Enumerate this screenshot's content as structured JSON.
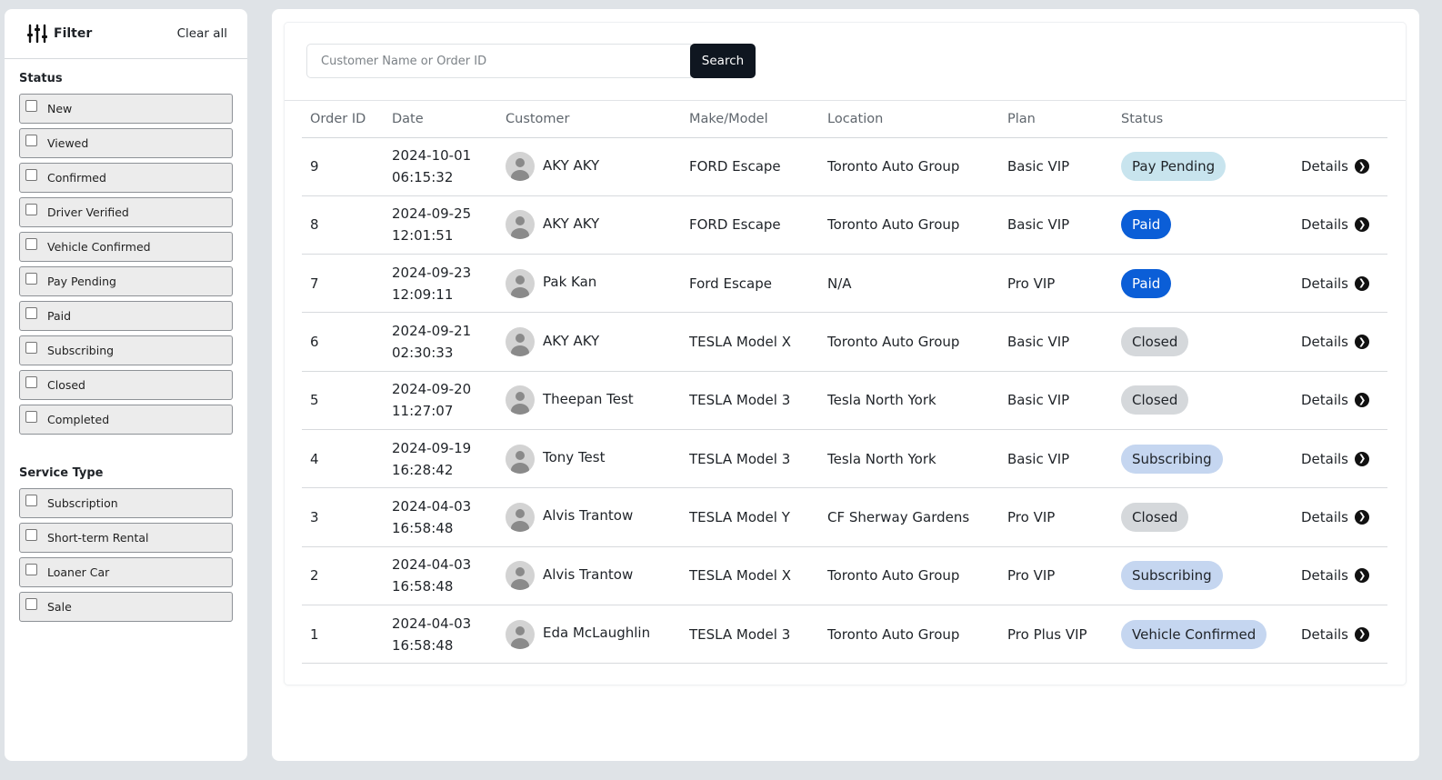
{
  "sidebar": {
    "title": "Filter",
    "clear_all": "Clear all",
    "status_title": "Status",
    "status_options": [
      "New",
      "Viewed",
      "Confirmed",
      "Driver Verified",
      "Vehicle Confirmed",
      "Pay Pending",
      "Paid",
      "Subscribing",
      "Closed",
      "Completed"
    ],
    "service_title": "Service Type",
    "service_options": [
      "Subscription",
      "Short-term Rental",
      "Loaner Car",
      "Sale"
    ]
  },
  "search": {
    "placeholder": "Customer Name or Order ID",
    "button": "Search"
  },
  "table": {
    "headers": [
      "Order ID",
      "Date",
      "Customer",
      "Make/Model",
      "Location",
      "Plan",
      "Status",
      ""
    ],
    "details_label": "Details",
    "status_colors": {
      "Pay Pending": {
        "bg": "#c8e4ee",
        "fg": "#1f2328"
      },
      "Paid": {
        "bg": "#0b5ed7",
        "fg": "#ffffff"
      },
      "Closed": {
        "bg": "#d5d8db",
        "fg": "#1f2328"
      },
      "Subscribing": {
        "bg": "#c5d6f0",
        "fg": "#1f2328"
      },
      "Vehicle Confirmed": {
        "bg": "#c5d6f0",
        "fg": "#1f2328"
      }
    },
    "rows": [
      {
        "id": "9",
        "date": "2024-10-01",
        "time": "06:15:32",
        "customer": "AKY AKY",
        "model": "FORD Escape",
        "location": "Toronto Auto Group",
        "plan": "Basic VIP",
        "status": "Pay Pending"
      },
      {
        "id": "8",
        "date": "2024-09-25",
        "time": "12:01:51",
        "customer": "AKY AKY",
        "model": "FORD Escape",
        "location": "Toronto Auto Group",
        "plan": "Basic VIP",
        "status": "Paid"
      },
      {
        "id": "7",
        "date": "2024-09-23",
        "time": "12:09:11",
        "customer": "Pak Kan",
        "model": "Ford Escape",
        "location": "N/A",
        "plan": "Pro VIP",
        "status": "Paid"
      },
      {
        "id": "6",
        "date": "2024-09-21",
        "time": "02:30:33",
        "customer": "AKY AKY",
        "model": "TESLA Model X",
        "location": "Toronto Auto Group",
        "plan": "Basic VIP",
        "status": "Closed"
      },
      {
        "id": "5",
        "date": "2024-09-20",
        "time": "11:27:07",
        "customer": "Theepan Test",
        "model": "TESLA Model 3",
        "location": "Tesla North York",
        "plan": "Basic VIP",
        "status": "Closed"
      },
      {
        "id": "4",
        "date": "2024-09-19",
        "time": "16:28:42",
        "customer": "Tony Test",
        "model": "TESLA Model 3",
        "location": "Tesla North York",
        "plan": "Basic VIP",
        "status": "Subscribing"
      },
      {
        "id": "3",
        "date": "2024-04-03",
        "time": "16:58:48",
        "customer": "Alvis Trantow",
        "model": "TESLA Model Y",
        "location": "CF Sherway Gardens",
        "plan": "Pro VIP",
        "status": "Closed"
      },
      {
        "id": "2",
        "date": "2024-04-03",
        "time": "16:58:48",
        "customer": "Alvis Trantow",
        "model": "TESLA Model X",
        "location": "Toronto Auto Group",
        "plan": "Pro VIP",
        "status": "Subscribing"
      },
      {
        "id": "1",
        "date": "2024-04-03",
        "time": "16:58:48",
        "customer": "Eda McLaughlin",
        "model": "TESLA Model 3",
        "location": "Toronto Auto Group",
        "plan": "Pro Plus VIP",
        "status": "Vehicle Confirmed"
      }
    ]
  }
}
